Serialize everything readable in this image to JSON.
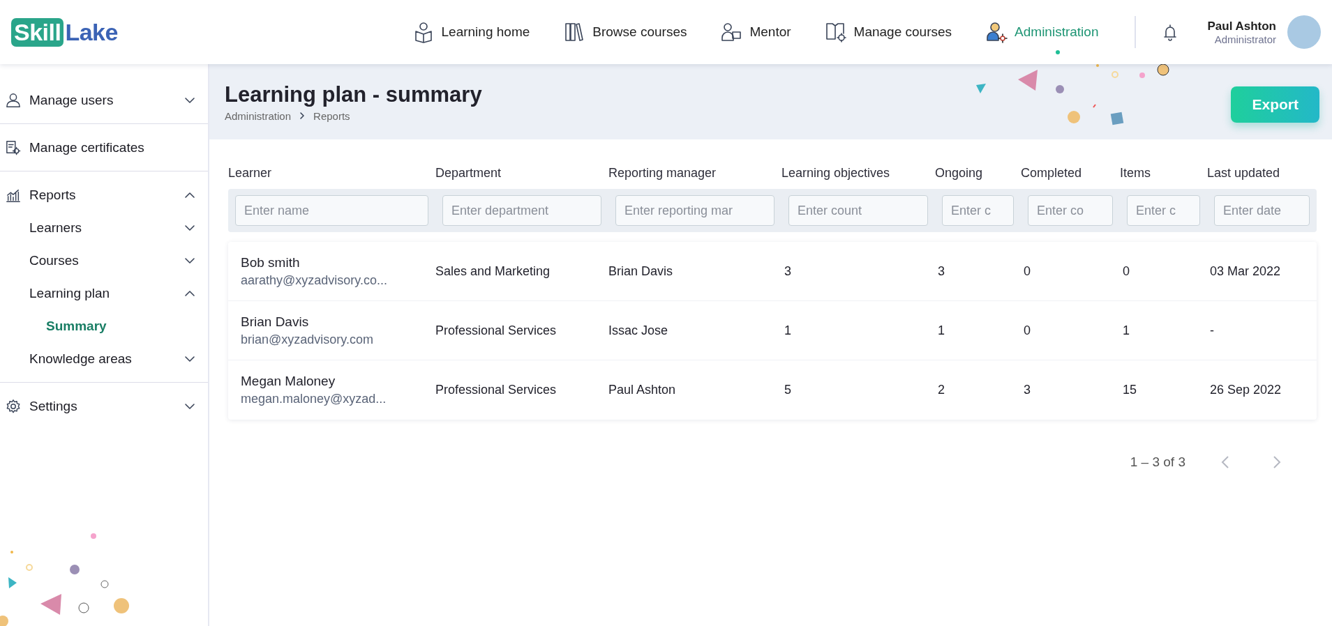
{
  "header": {
    "logo": {
      "part_1": "Skill",
      "part_2": "Lake"
    },
    "nav": [
      {
        "label": "Learning home",
        "selected": false
      },
      {
        "label": "Browse courses",
        "selected": false
      },
      {
        "label": "Mentor",
        "selected": false
      },
      {
        "label": "Manage courses",
        "selected": false
      },
      {
        "label": "Administration",
        "selected": true
      }
    ],
    "user": {
      "name": "Paul Ashton",
      "role": "Administrator"
    }
  },
  "sidebar": {
    "items": [
      {
        "label": "Manage users",
        "kind": "group",
        "expanded": false,
        "selected": false
      },
      {
        "label": "Manage certificates",
        "kind": "link",
        "selected": false
      },
      {
        "label": "Reports",
        "kind": "group",
        "expanded": true,
        "selected": false,
        "children": [
          {
            "label": "Learners",
            "kind": "group",
            "expanded": false,
            "selected": false
          },
          {
            "label": "Courses",
            "kind": "group",
            "expanded": false,
            "selected": false
          },
          {
            "label": "Learning plan",
            "kind": "group",
            "expanded": true,
            "selected": false,
            "children": [
              {
                "label": "Summary",
                "kind": "link",
                "selected": true
              }
            ]
          },
          {
            "label": "Knowledge areas",
            "kind": "group",
            "expanded": false,
            "selected": false
          }
        ]
      },
      {
        "label": "Settings",
        "kind": "group",
        "expanded": false,
        "selected": false
      }
    ]
  },
  "page": {
    "title": "Learning plan - summary",
    "breadcrumb": [
      "Administration",
      "Reports"
    ],
    "export_button": "Export"
  },
  "table": {
    "columns": [
      {
        "label": "Learner",
        "placeholder": "Enter name"
      },
      {
        "label": "Department",
        "placeholder": "Enter department"
      },
      {
        "label": "Reporting manager",
        "placeholder": "Enter reporting mar"
      },
      {
        "label": "Learning objectives",
        "placeholder": "Enter count"
      },
      {
        "label": "Ongoing",
        "placeholder": "Enter c"
      },
      {
        "label": "Completed",
        "placeholder": "Enter co"
      },
      {
        "label": "Items",
        "placeholder": "Enter c"
      },
      {
        "label": "Last updated",
        "placeholder": "Enter date"
      }
    ],
    "rows": [
      {
        "cells": [
          {
            "name": "Bob smith",
            "email": "aarathy@xyzadvisory.co..."
          },
          "Sales and Marketing",
          "Brian Davis",
          "3",
          "3",
          "0",
          "0",
          "03 Mar 2022"
        ]
      },
      {
        "cells": [
          {
            "name": "Brian Davis",
            "email": "brian@xyzadvisory.com"
          },
          "Professional Services",
          "Issac Jose",
          "1",
          "1",
          "0",
          "1",
          "-"
        ]
      },
      {
        "cells": [
          {
            "name": "Megan Maloney",
            "email": "megan.maloney@xyzad..."
          },
          "Professional Services",
          "Paul Ashton",
          "5",
          "2",
          "3",
          "15",
          "26 Sep 2022"
        ]
      }
    ]
  },
  "pagination": {
    "range": "1 – 3 of 3",
    "prev_disabled": true,
    "next_disabled": true
  }
}
